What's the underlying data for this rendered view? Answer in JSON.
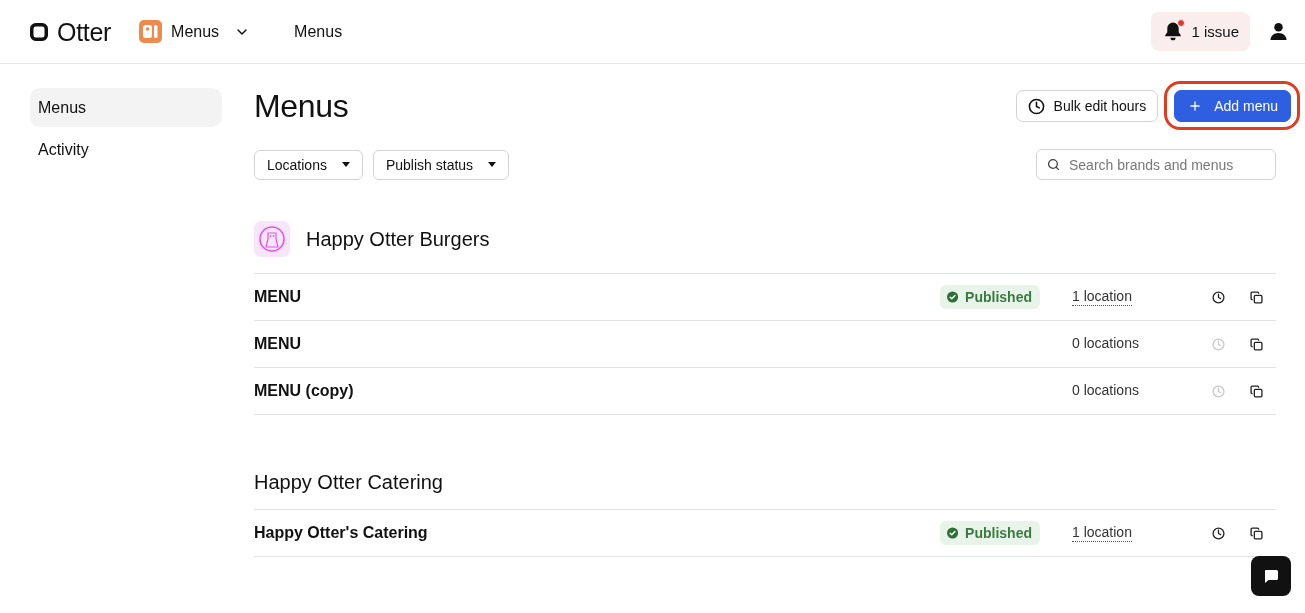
{
  "header": {
    "logo": "Otter",
    "app_switcher": "Menus",
    "page_title": "Menus",
    "issues": {
      "label": "1 issue",
      "alert": true
    }
  },
  "sidebar": {
    "items": [
      {
        "label": "Menus",
        "selected": true
      },
      {
        "label": "Activity",
        "selected": false
      }
    ]
  },
  "main": {
    "title": "Menus",
    "actions": [
      {
        "kind": "outline",
        "label": "Bulk edit hours",
        "highlighted": false
      },
      {
        "kind": "primary",
        "label": "Add menu",
        "highlighted": true
      }
    ],
    "filters": [
      {
        "label": "Locations"
      },
      {
        "label": "Publish status"
      }
    ],
    "search": {
      "placeholder": "Search brands and menus"
    }
  },
  "brands": [
    {
      "name": "Happy Otter Burgers",
      "logo": true,
      "menus": [
        {
          "name": "MENU",
          "status": "Published",
          "locations": "1 location",
          "locations_link": true,
          "hours_enabled": true
        },
        {
          "name": "MENU",
          "locations": "0 locations",
          "locations_link": false,
          "hours_enabled": false
        },
        {
          "name": "MENU (copy)",
          "locations": "0 locations",
          "locations_link": false,
          "hours_enabled": false
        }
      ]
    },
    {
      "name": "Happy Otter Catering",
      "logo": false,
      "menus": [
        {
          "name": "Happy Otter's Catering",
          "status": "Published",
          "locations": "1 location",
          "locations_link": true,
          "hours_enabled": true
        }
      ]
    }
  ]
}
